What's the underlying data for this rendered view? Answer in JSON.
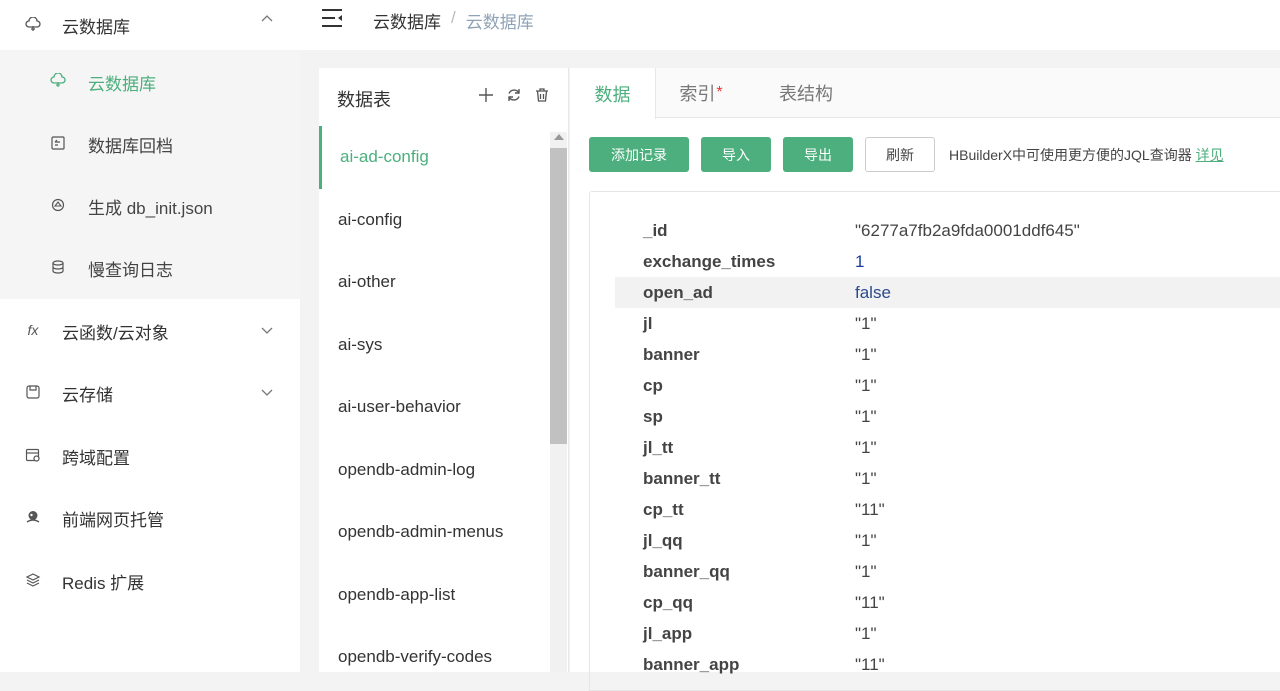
{
  "sidebar": {
    "group_title": "云数据库",
    "sub_items": [
      {
        "label": "云数据库"
      },
      {
        "label": "数据库回档"
      },
      {
        "label": "生成 db_init.json"
      },
      {
        "label": "慢查询日志"
      }
    ],
    "menu_items": [
      {
        "label": "云函数/云对象",
        "icon_text": "fx"
      },
      {
        "label": "云存储"
      },
      {
        "label": "跨域配置"
      },
      {
        "label": "前端网页托管"
      },
      {
        "label": "Redis 扩展"
      }
    ]
  },
  "breadcrumb": [
    "云数据库",
    "/",
    "云数据库"
  ],
  "table_panel": {
    "title": "数据表",
    "tables": [
      "ai-ad-config",
      "ai-config",
      "ai-other",
      "ai-sys",
      "ai-user-behavior",
      "opendb-admin-log",
      "opendb-admin-menus",
      "opendb-app-list",
      "opendb-verify-codes"
    ],
    "active_index": 0
  },
  "tabs": [
    {
      "label": "数据"
    },
    {
      "label": "索引",
      "marker": "*"
    },
    {
      "label": "表结构"
    }
  ],
  "toolbar": {
    "add_label": "添加记录",
    "import_label": "导入",
    "export_label": "导出",
    "refresh_label": "刷新",
    "hint": "HBuilderX中可使用更方便的JQL查询器",
    "hint_link": "详见"
  },
  "record": [
    {
      "key": "_id",
      "value": "\"6277a7fb2a9fda0001ddf645\""
    },
    {
      "key": "exchange_times",
      "value": "1"
    },
    {
      "key": "open_ad",
      "value": "false"
    },
    {
      "key": "jl",
      "value": "\"1\""
    },
    {
      "key": "banner",
      "value": "\"1\""
    },
    {
      "key": "cp",
      "value": "\"1\""
    },
    {
      "key": "sp",
      "value": "\"1\""
    },
    {
      "key": "jl_tt",
      "value": "\"1\""
    },
    {
      "key": "banner_tt",
      "value": "\"1\""
    },
    {
      "key": "cp_tt",
      "value": "\"11\""
    },
    {
      "key": "jl_qq",
      "value": "\"1\""
    },
    {
      "key": "banner_qq",
      "value": "\"1\""
    },
    {
      "key": "cp_qq",
      "value": "\"11\""
    },
    {
      "key": "jl_app",
      "value": "\"1\""
    },
    {
      "key": "banner_app",
      "value": "\"11\""
    }
  ],
  "colors": {
    "accent": "#4caf7d",
    "number": "#1a3d9c",
    "required": "#e53935"
  }
}
